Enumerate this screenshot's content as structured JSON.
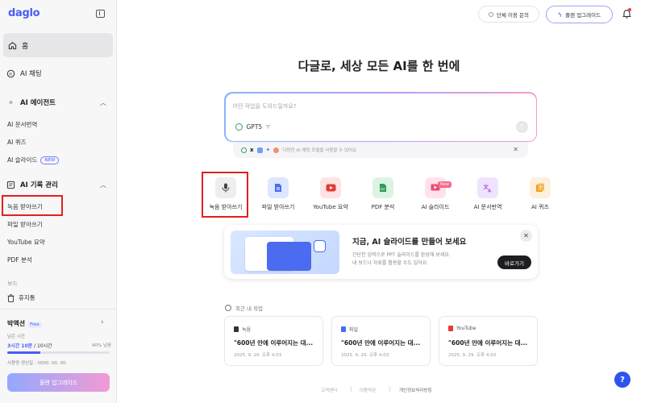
{
  "app": {
    "logo": "daglo"
  },
  "sidebar": {
    "home": "홈",
    "ai_chat": "AI 채팅",
    "agents": {
      "title": "AI 에이전트",
      "items": [
        "AI 문서번역",
        "AI 퀴즈",
        "AI 슬라이드"
      ],
      "new_badge": "NEW"
    },
    "records": {
      "title": "AI 기록 관리",
      "items": [
        "녹음 받아쓰기",
        "파일 받아쓰기",
        "YouTube 요약",
        "PDF 분석"
      ]
    },
    "board_label": "보드",
    "trash": "휴지통",
    "user": {
      "name": "박액션",
      "plan_badge": "Free",
      "remaining_label": "남은 시간",
      "remaining_value": "3시간 10분",
      "remaining_total": " / 10시간",
      "remaining_pct": "40% 남음",
      "remaining_fraction": 0.32,
      "reset_text": "사용량 갱신일 : 0000. 00. 00.",
      "upgrade_button": "플랜 업그레이드"
    }
  },
  "header": {
    "group_inquiry": "단체 이용 문의",
    "plan_upgrade": "플랜 업그레이드"
  },
  "main": {
    "headline": "다글로, 세상 모든 AI를 한 번에",
    "input_placeholder": "어떤 작업을 도와드릴까요?",
    "model": "GPT5",
    "tools_hint": "다양한 AI 채팅 모델을 사용할 수 있어요",
    "features": [
      {
        "label": "녹음 받아쓰기",
        "icon": "mic-icon",
        "color": "#eeeeef",
        "fg": "#444"
      },
      {
        "label": "파일 받아쓰기",
        "icon": "file-icon",
        "color": "#dde7ff",
        "fg": "#4a6cf0"
      },
      {
        "label": "YouTube 요약",
        "icon": "youtube-icon",
        "color": "#ffe3e3",
        "fg": "#e53935"
      },
      {
        "label": "PDF 분석",
        "icon": "pdf-icon",
        "color": "#dcf3e3",
        "fg": "#2e9d5b"
      },
      {
        "label": "AI 슬라이드",
        "icon": "slide-icon",
        "color": "#ffe2ea",
        "fg": "#e94d74",
        "new": "New"
      },
      {
        "label": "AI 문서번역",
        "icon": "translate-icon",
        "color": "#f0e3ff",
        "fg": "#a155e0"
      },
      {
        "label": "AI 퀴즈",
        "icon": "quiz-icon",
        "color": "#fff0dc",
        "fg": "#f09a20"
      }
    ],
    "promo": {
      "title": "지금, AI 슬라이드를 만들어 보세요",
      "desc_line1": "간단한 입력으로 PPT 슬라이드를 완성해 보세요.",
      "desc_line2": "내 보드나 자료를 활용할 수도 있어요.",
      "button": "바로가기"
    },
    "recent": {
      "label": "최근 내 작업",
      "cards": [
        {
          "tag": "녹음",
          "title": "\"600년 만에 이루어지는 대...",
          "date": "2025. 9. 29. 오후 4:03",
          "tag_color": "#333"
        },
        {
          "tag": "파일",
          "title": "\"600년 만에 이루어지는 대...",
          "date": "2025. 9. 29. 오후 4:03",
          "tag_color": "#4a6cf0"
        },
        {
          "tag": "YouTube",
          "title": "\"600년 만에 이루어지는 대...",
          "date": "2025. 9. 29. 오후 4:03",
          "tag_color": "#e53935"
        }
      ]
    }
  },
  "footer": {
    "links": [
      "고객센터",
      "이용약관",
      "개인정보처리방침"
    ]
  },
  "help_button": "?"
}
